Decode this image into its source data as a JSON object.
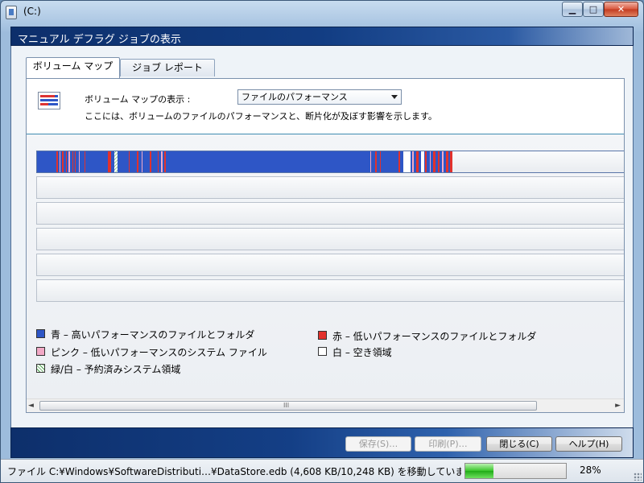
{
  "window": {
    "title": "(C:)",
    "minimize_glyph": "▁",
    "maximize_glyph": "□",
    "close_glyph": "✕"
  },
  "header": {
    "title": "マニュアル デフラグ ジョブの表示"
  },
  "tabs": [
    {
      "label": "ボリューム マップ",
      "active": true
    },
    {
      "label": "ジョブ レポート",
      "active": false
    }
  ],
  "panel": {
    "show_label": "ボリューム マップの表示 :",
    "view_select": {
      "value": "ファイルのパフォーマンス"
    },
    "description": "ここには、ボリュームのファイルのパフォーマンスと、断片化が及ぼす影響を示します。"
  },
  "legend": [
    {
      "color": "#2e56c6",
      "label": "青 – 高いパフォーマンスのファイルとフォルダ"
    },
    {
      "color": "#e2312c",
      "label": "赤 – 低いパフォーマンスのファイルとフォルダ"
    },
    {
      "color": "#f2a9c6",
      "label": "ピンク – 低いパフォーマンスのシステム ファイル"
    },
    {
      "color": "#ffffff",
      "label": "白 – 空き領域"
    },
    {
      "color": "hatch",
      "label": "緑/白 – 予約済みシステム領域"
    }
  ],
  "buttons": {
    "save": "保存(S)…",
    "print": "印刷(P)…",
    "close": "閉じる(C)",
    "help": "ヘルプ(H)"
  },
  "status": {
    "text": "ファイル C:¥Windows¥SoftwareDistributi…¥DataStore.edb (4,608 KB/10,248 KB) を移動していま",
    "progress_percent": 28,
    "progress_label": "28%"
  },
  "scrollbar": {
    "left_arrow": "◄",
    "right_arrow": "►",
    "grip": "III"
  },
  "colors": {
    "accent": "#123d83",
    "high_perf": "#2e56c6",
    "low_perf": "#e2312c"
  }
}
